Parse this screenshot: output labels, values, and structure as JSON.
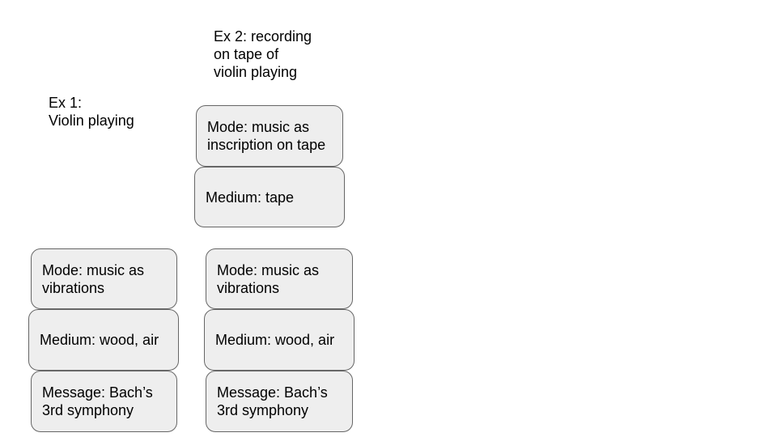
{
  "examples": [
    {
      "caption": "Ex 1:\nViolin playing",
      "layers": [
        "Mode: music as\nvibrations",
        "Medium: wood, air",
        "Message: Bach’s\n3rd symphony"
      ]
    },
    {
      "caption": "Ex 2: recording\non tape of\nviolin playing",
      "layers": [
        "Mode: music as\ninscription on tape",
        "Medium: tape",
        "Mode: music as\nvibrations",
        "Medium: wood, air",
        "Message: Bach’s\n3rd symphony"
      ]
    }
  ],
  "colors": {
    "box_fill": "#eeeeee",
    "box_border": "#666666",
    "text": "#000000",
    "background": "#ffffff"
  }
}
